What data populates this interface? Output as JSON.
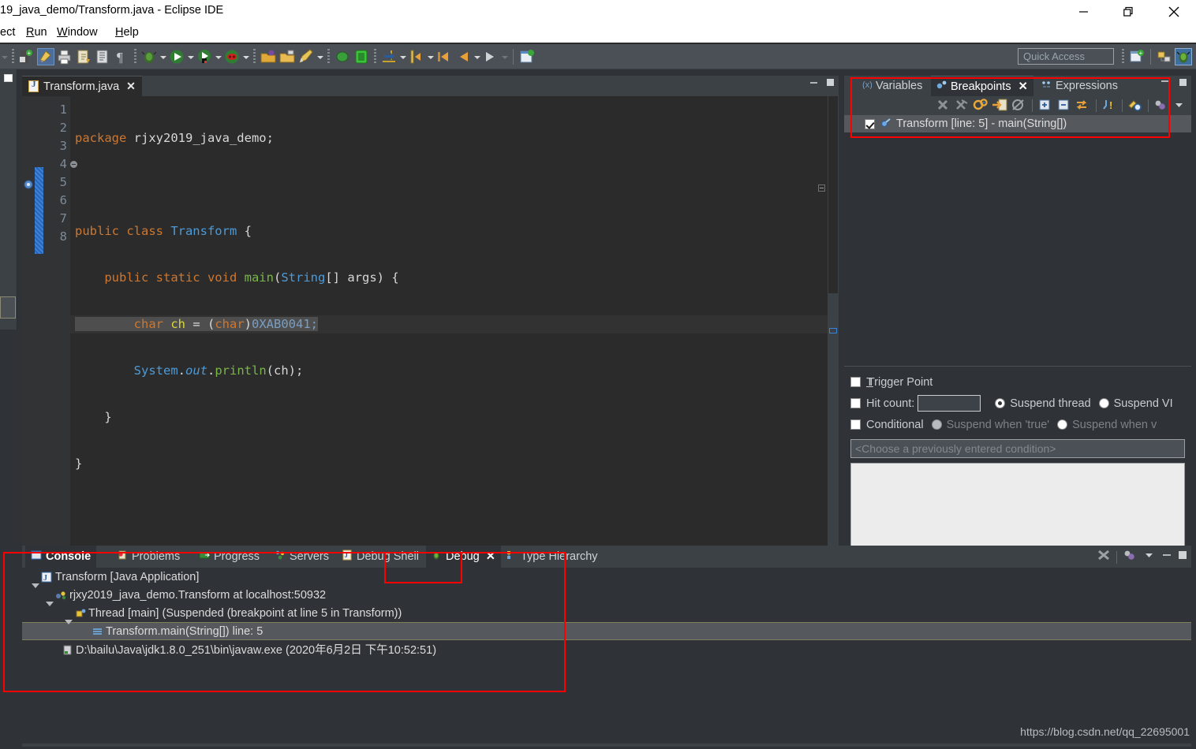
{
  "window": {
    "title": "19_java_demo/Transform.java - Eclipse IDE",
    "minimize_label": "minimize",
    "maximize_label": "maximize",
    "close_label": "close"
  },
  "menubar": {
    "items": [
      {
        "label": "ect",
        "mnemonic": ""
      },
      {
        "label": "Run",
        "mnemonic": "R"
      },
      {
        "label": "Window",
        "mnemonic": "W"
      },
      {
        "label": "Help",
        "mnemonic": "H"
      }
    ]
  },
  "toolbar": {
    "quick_access_placeholder": "Quick Access",
    "icons": [
      "new-wizard-dropdown-icon",
      "save-icon",
      "print-icon",
      "highlight-icon",
      "skip-breakpoints-icon",
      "open-type-icon",
      "show-whitespace-icon",
      "debug-icon",
      "debug-dropdown-icon",
      "run-icon",
      "run-dropdown-icon",
      "coverage-icon",
      "coverage-dropdown-icon",
      "stop-icon",
      "stop-dropdown-icon",
      "open-folder-icon",
      "open-folder-2-icon",
      "edit-icon",
      "edit-dropdown-icon",
      "external-tools-icon",
      "java-perspective-icon",
      "step-into-icon",
      "step-into-dropdown-icon",
      "step-over-icon",
      "step-over-dropdown-icon",
      "back-icon",
      "back-2-icon",
      "back-dropdown-icon",
      "forward-icon",
      "forward-dropdown-icon",
      "new-window-icon"
    ],
    "right_icons": [
      "open-perspective-icon",
      "java-perspective-icon",
      "debug-perspective-icon"
    ]
  },
  "editor": {
    "tab": {
      "label": "Transform.java",
      "close": "✕",
      "icon": "java-file-icon"
    },
    "minimize_label": "–",
    "maximize_label": "■",
    "lines": [
      {
        "n": "1",
        "fold": false
      },
      {
        "n": "2",
        "fold": false
      },
      {
        "n": "3",
        "fold": false
      },
      {
        "n": "4",
        "fold": true
      },
      {
        "n": "5",
        "fold": false
      },
      {
        "n": "6",
        "fold": false
      },
      {
        "n": "7",
        "fold": false
      },
      {
        "n": "8",
        "fold": false
      }
    ],
    "code": {
      "line1_kw": "package",
      "line1_pkg": " rjxy2019_java_demo;",
      "line3_kw": "public class",
      "line3_cls": " Transform",
      "line3_brace": " {",
      "line4_kw": "    public static void",
      "line4_m": " main",
      "line4_p1": "(",
      "line4_cls": "String",
      "line4_p2": "[] args",
      "line4_p3": ") {",
      "line5_kw": "        char",
      "line5_v": " ch",
      "line5_eq": " = ",
      "line5_p1": "(",
      "line5_kw2": "char",
      "line5_p2": ")",
      "line5_num": "0XAB0041",
      "line5_semi": ";",
      "line6_cls": "        System",
      "line6_dot1": ".",
      "line6_out": "out",
      "line6_dot2": ".",
      "line6_m": "println",
      "line6_rest": "(ch);",
      "line7": "    }",
      "line8": "}"
    }
  },
  "breakpoints_view": {
    "tabs": [
      {
        "label": "Variables",
        "active": false,
        "icon": "variables-icon"
      },
      {
        "label": "Breakpoints",
        "active": true,
        "icon": "breakpoint-icon",
        "close": "✕"
      },
      {
        "label": "Expressions",
        "active": false,
        "icon": "expressions-icon"
      }
    ],
    "minimize_label": "–",
    "maximize_label": "■",
    "toolbar_icons": [
      "remove-breakpoint-icon",
      "remove-all-breakpoints-icon",
      "link-with-debug-view-icon",
      "go-to-file-icon",
      "skip-all-breakpoints-icon",
      "expand-all-icon",
      "collapse-all-icon",
      "working-sets-icon",
      "add-java-exception-breakpoint-icon",
      "add-watchpoint-icon",
      "breakpoint-group-icon",
      "view-menu-icon"
    ],
    "rows": [
      {
        "label": "Transform [line: 5] - main(String[])",
        "checked": true,
        "icon": "breakpoint-marker-icon"
      }
    ]
  },
  "breakpoint_properties": {
    "trigger_point": {
      "label": "Trigger Point",
      "checked": false
    },
    "hit_count": {
      "label": "Hit count:",
      "checked": false,
      "value": ""
    },
    "suspend_thread": {
      "label": "Suspend thread",
      "selected": true
    },
    "suspend_vm": {
      "label": "Suspend VI",
      "selected": false
    },
    "conditional": {
      "label": "Conditional",
      "checked": false
    },
    "suspend_when_true": {
      "label": "Suspend when 'true'",
      "selected": false,
      "disabled": true
    },
    "suspend_when_value": {
      "label": "Suspend when v",
      "selected": false,
      "disabled": true
    },
    "condition_placeholder": "<Choose a previously entered condition>"
  },
  "bottom_panel": {
    "tabs": [
      {
        "label": "Console",
        "icon": "console-icon",
        "selected": true
      },
      {
        "label": "Problems",
        "icon": "problems-icon",
        "selected": false
      },
      {
        "label": "Progress",
        "icon": "progress-icon",
        "selected": false
      },
      {
        "label": "Servers",
        "icon": "servers-icon",
        "selected": false
      },
      {
        "label": "Debug Shell",
        "icon": "debug-shell-icon",
        "selected": false
      },
      {
        "label": "Debug",
        "icon": "debug-tab-icon",
        "selected": false,
        "close": "✕"
      },
      {
        "label": "Type Hierarchy",
        "icon": "type-hierarchy-icon",
        "selected": false
      }
    ],
    "controls": [
      "skip-breakpoints-icon",
      "debug-menu-icon",
      "view-menu-icon",
      "minimize-icon",
      "maximize-icon"
    ],
    "tree": [
      {
        "depth": 0,
        "label": "Transform [Java Application]",
        "icon": "java-app-icon",
        "expanded": true,
        "selected": false
      },
      {
        "depth": 1,
        "label": "rjxy2019_java_demo.Transform at localhost:50932",
        "icon": "debug-target-icon",
        "expanded": true,
        "selected": false
      },
      {
        "depth": 2,
        "label": "Thread [main] (Suspended (breakpoint at line 5 in Transform))",
        "icon": "thread-icon",
        "expanded": true,
        "selected": false
      },
      {
        "depth": 3,
        "label": "Transform.main(String[]) line: 5",
        "icon": "stack-frame-icon",
        "expanded": false,
        "selected": true
      },
      {
        "depth": 1,
        "label": "D:\\bailu\\Java\\jdk1.8.0_251\\bin\\javaw.exe (2020年6月2日 下午10:52:51)",
        "icon": "process-icon",
        "expanded": false,
        "selected": false
      }
    ]
  },
  "watermark": "https://blog.csdn.net/qq_22695001",
  "colors": {
    "titlebar_bg": "#ffffff",
    "toolbar_bg": "#4a5055",
    "workbench_bg": "#2f3337",
    "editor_bg": "#2b2b2b",
    "gutter_bg": "#313335",
    "tab_active_bg": "#2f3337",
    "selection_bg": "#55595d",
    "annotation_red": "#ff0000",
    "keyword_orange": "#cc7832",
    "class_blue": "#4e9ad6",
    "method_green": "#7ab648",
    "variable_yellow": "#d8d83c",
    "number_blue": "#7a9ec2",
    "text_light": "#d8d8d8",
    "line_number": "#7d8b99",
    "breakpoint_blue": "#3b82d9",
    "scrollbar_green": "#3ddb3d"
  }
}
